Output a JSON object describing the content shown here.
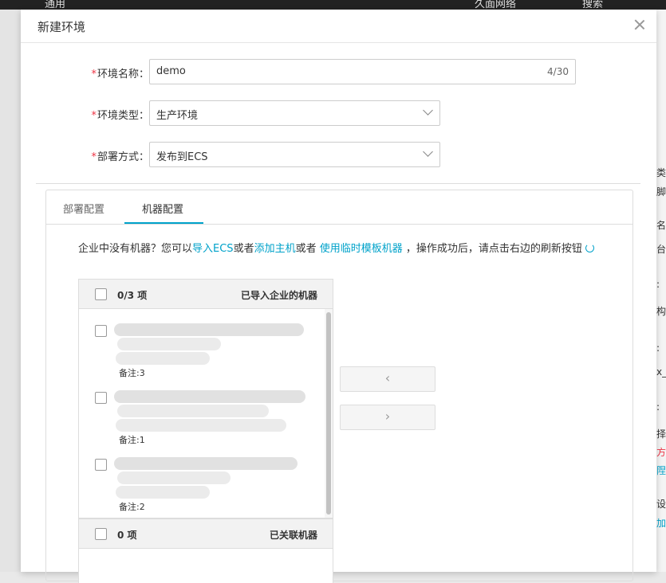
{
  "background": {
    "top_items": [
      "通用",
      "久面网络",
      "搜索"
    ],
    "right_fragments": [
      "类",
      "脚本",
      "名",
      "台",
      ":",
      "构",
      ":",
      "x_",
      ":",
      "择",
      "方",
      "陧",
      "设置",
      "加"
    ]
  },
  "modal": {
    "title": "新建环境",
    "close_icon": "close-icon"
  },
  "form": {
    "name": {
      "label": "环境名称：",
      "value": "demo",
      "count": "4/30"
    },
    "type": {
      "label": "环境类型：",
      "value": "生产环境"
    },
    "deploy": {
      "label": "部署方式：",
      "value": "发布到ECS"
    },
    "required_mark": "*"
  },
  "tabs": [
    {
      "label": "部署配置",
      "active": false
    },
    {
      "label": "机器配置",
      "active": true
    }
  ],
  "hint": {
    "prefix": "企业中没有机器？您可以",
    "link1": "导入ECS",
    "mid1": "或者",
    "link2": "添加主机",
    "mid2": "或者 ",
    "link3": "使用临时模板机器",
    "suffix": " ，操作成功后，请点击右边的刷新按钮"
  },
  "imported_list": {
    "count": "0/3 项",
    "title": "已导入企业的机器",
    "items": [
      {
        "remark": "备注:3"
      },
      {
        "remark": "备注:1"
      },
      {
        "remark": "备注:2"
      }
    ]
  },
  "linked_list": {
    "count": "0 项",
    "title": "已关联机器"
  },
  "transfer": {
    "left_arrow": "‹",
    "right_arrow": "›"
  },
  "colors": {
    "accent": "#00a2ca",
    "required": "#e34"
  }
}
